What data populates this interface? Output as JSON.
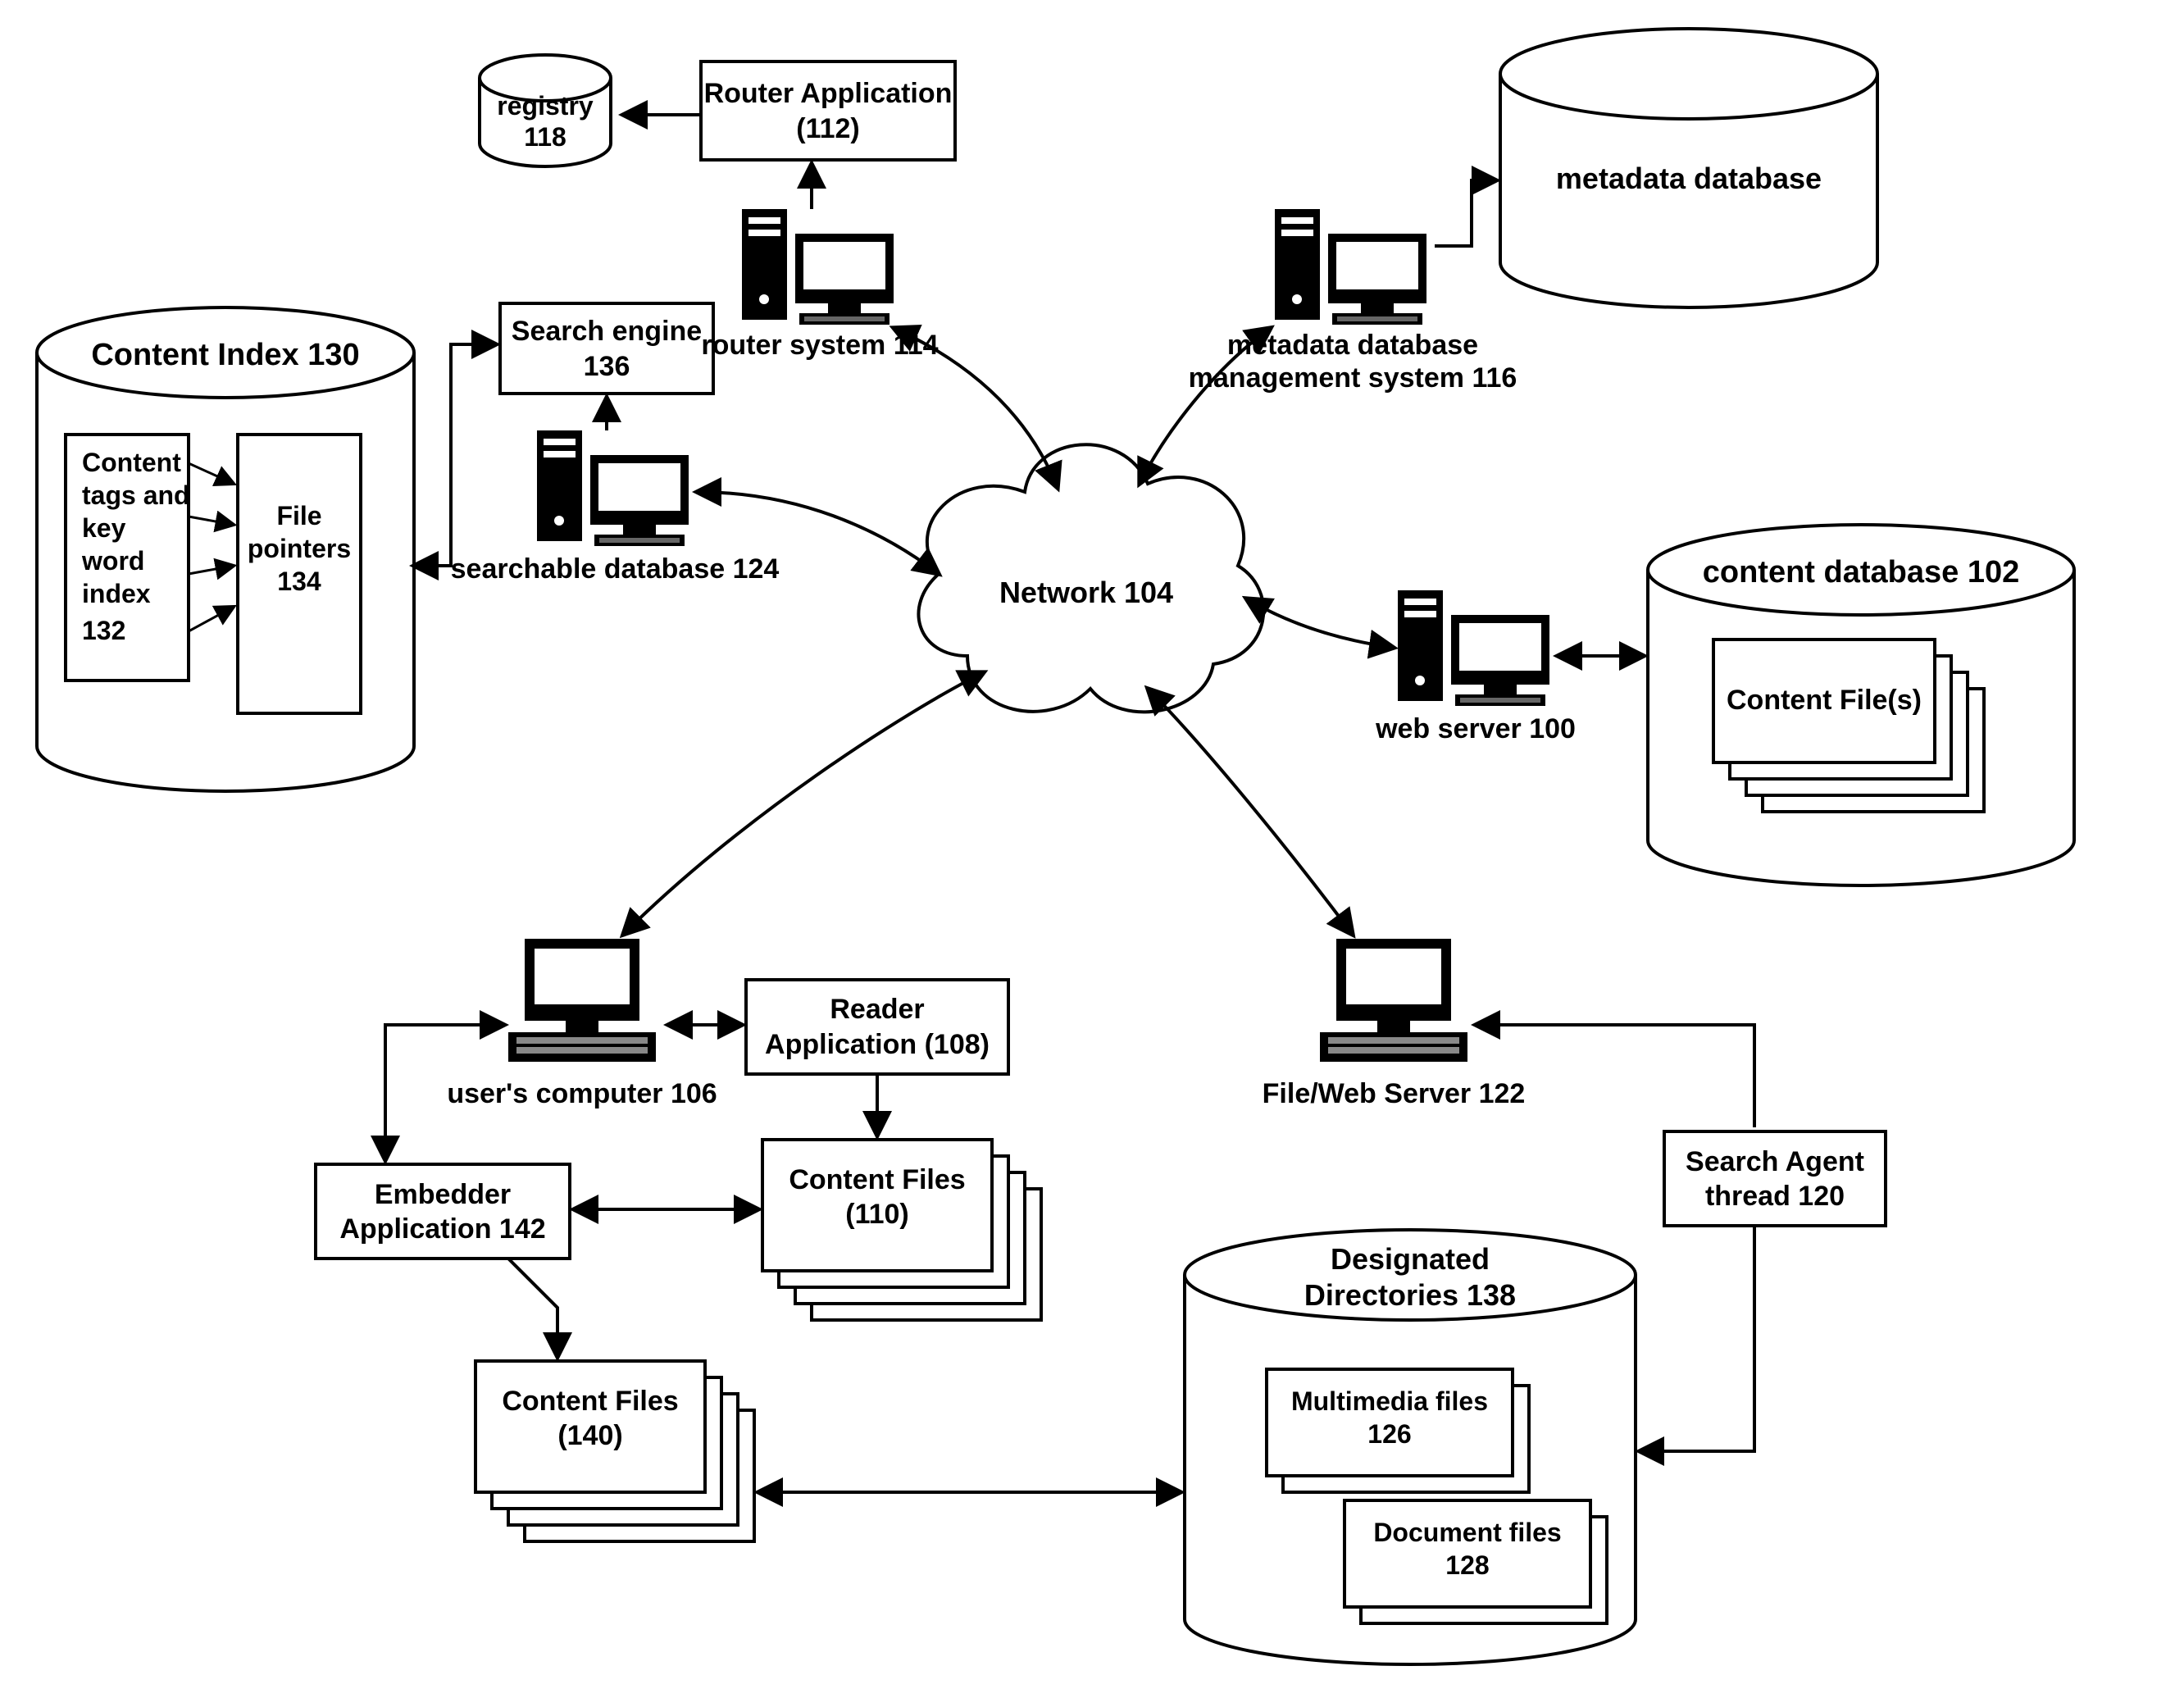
{
  "network": {
    "label": "Network 104"
  },
  "router_app": {
    "label1": "Router Application",
    "label2": "(112)"
  },
  "registry": {
    "label1": "registry",
    "label2": "118"
  },
  "router_system": {
    "label": "router system 114"
  },
  "metadata_mgmt": {
    "label1": "metadata database",
    "label2": "management system 116"
  },
  "metadata_db": {
    "label": "metadata database"
  },
  "search_engine": {
    "label1": "Search engine",
    "label2": "136"
  },
  "searchable_db": {
    "label": "searchable database 124"
  },
  "content_index": {
    "title": "Content Index 130",
    "tags1": "Content",
    "tags2": "tags and",
    "tags3": "key",
    "tags4": "word",
    "tags5": "index",
    "tags6": "132",
    "ptr1": "File",
    "ptr2": "pointers",
    "ptr3": "134"
  },
  "content_db": {
    "title": "content database 102",
    "file": "Content File(s)"
  },
  "web_server": {
    "label": "web server 100"
  },
  "user_computer": {
    "label": "user's computer 106"
  },
  "reader_app": {
    "label1": "Reader",
    "label2": "Application (108)"
  },
  "content_110": {
    "label1": "Content Files",
    "label2": "(110)"
  },
  "embedder": {
    "label1": "Embedder",
    "label2": "Application 142"
  },
  "content_140": {
    "label1": "Content Files",
    "label2": "(140)"
  },
  "file_server": {
    "label": "File/Web Server 122"
  },
  "search_agent": {
    "label1": "Search Agent",
    "label2": "thread 120"
  },
  "designated": {
    "title1": "Designated",
    "title2": "Directories 138",
    "mm1": "Multimedia files",
    "mm2": "126",
    "doc1": "Document files",
    "doc2": "128"
  }
}
